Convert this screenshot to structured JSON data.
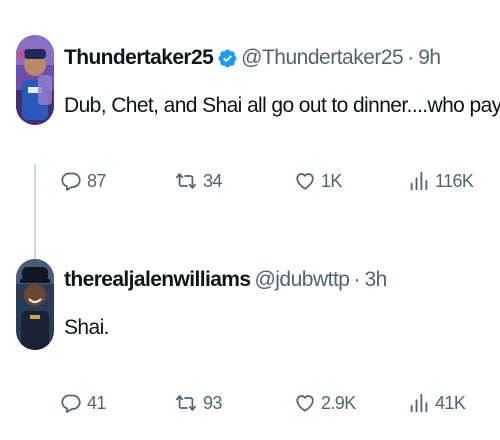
{
  "thread": {
    "tweets": [
      {
        "display_name": "Thundertaker25",
        "verified": true,
        "handle": "@Thundertaker25",
        "separator": "·",
        "time": "9h",
        "text": "Dub, Chet, and Shai all go out to dinner....who pays?",
        "actions": {
          "replies": "87",
          "reposts": "34",
          "likes": "1K",
          "views": "116K"
        }
      },
      {
        "display_name": "therealjalenwilliams",
        "verified": false,
        "handle": "@jdubwttp",
        "separator": "·",
        "time": "3h",
        "text": "Shai.",
        "actions": {
          "replies": "41",
          "reposts": "93",
          "likes": "2.9K",
          "views": "41K"
        }
      }
    ]
  },
  "colors": {
    "text_primary": "#0f1419",
    "text_secondary": "#536471",
    "verified_blue": "#1d9bf0",
    "thread_line": "#cfd9de"
  },
  "icons": {
    "reply": "reply-icon",
    "repost": "repost-icon",
    "like": "like-icon",
    "views": "views-icon",
    "verified": "verified-badge-icon"
  }
}
